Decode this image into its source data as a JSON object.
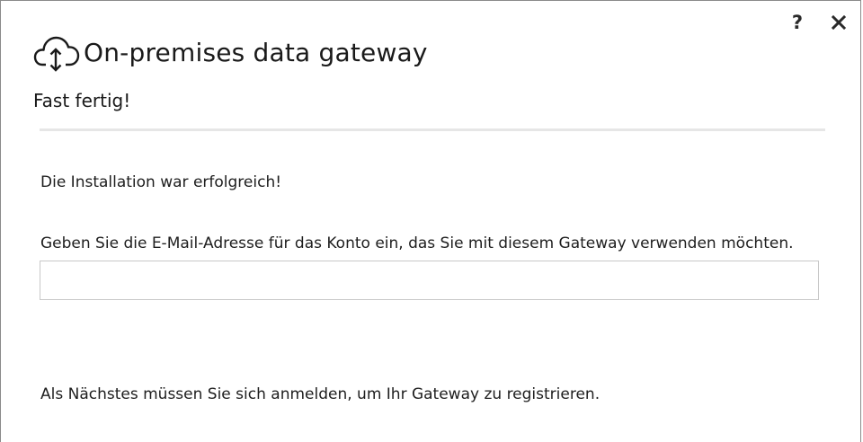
{
  "window": {
    "title": "On-premises data gateway",
    "help_label": "?",
    "icons": {
      "app": "cloud-upload-download-icon",
      "close": "close-icon"
    }
  },
  "step": {
    "title": "Fast fertig!"
  },
  "content": {
    "success_message": "Die Installation war erfolgreich!",
    "email_label": "Geben Sie die E-Mail-Adresse für das Konto ein, das Sie mit diesem Gateway verwenden möchten.",
    "email_value": "",
    "email_placeholder": "",
    "next_step_message": "Als Nächstes müssen Sie sich anmelden, um Ihr Gateway zu registrieren."
  },
  "colors": {
    "text": "#1e1e1e",
    "divider": "#e6e6e6",
    "input_border": "#c8c8c8",
    "window_border": "#8a8a8a"
  }
}
